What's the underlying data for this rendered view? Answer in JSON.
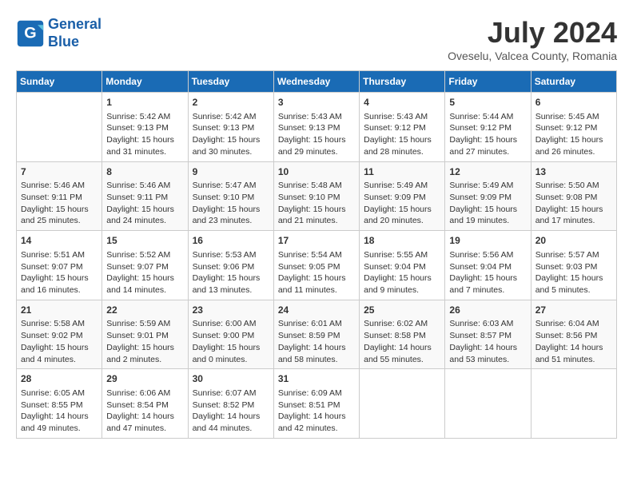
{
  "header": {
    "logo_line1": "General",
    "logo_line2": "Blue",
    "month": "July 2024",
    "location": "Oveselu, Valcea County, Romania"
  },
  "weekdays": [
    "Sunday",
    "Monday",
    "Tuesday",
    "Wednesday",
    "Thursday",
    "Friday",
    "Saturday"
  ],
  "weeks": [
    [
      {
        "day": "",
        "info": ""
      },
      {
        "day": "1",
        "info": "Sunrise: 5:42 AM\nSunset: 9:13 PM\nDaylight: 15 hours\nand 31 minutes."
      },
      {
        "day": "2",
        "info": "Sunrise: 5:42 AM\nSunset: 9:13 PM\nDaylight: 15 hours\nand 30 minutes."
      },
      {
        "day": "3",
        "info": "Sunrise: 5:43 AM\nSunset: 9:13 PM\nDaylight: 15 hours\nand 29 minutes."
      },
      {
        "day": "4",
        "info": "Sunrise: 5:43 AM\nSunset: 9:12 PM\nDaylight: 15 hours\nand 28 minutes."
      },
      {
        "day": "5",
        "info": "Sunrise: 5:44 AM\nSunset: 9:12 PM\nDaylight: 15 hours\nand 27 minutes."
      },
      {
        "day": "6",
        "info": "Sunrise: 5:45 AM\nSunset: 9:12 PM\nDaylight: 15 hours\nand 26 minutes."
      }
    ],
    [
      {
        "day": "7",
        "info": "Sunrise: 5:46 AM\nSunset: 9:11 PM\nDaylight: 15 hours\nand 25 minutes."
      },
      {
        "day": "8",
        "info": "Sunrise: 5:46 AM\nSunset: 9:11 PM\nDaylight: 15 hours\nand 24 minutes."
      },
      {
        "day": "9",
        "info": "Sunrise: 5:47 AM\nSunset: 9:10 PM\nDaylight: 15 hours\nand 23 minutes."
      },
      {
        "day": "10",
        "info": "Sunrise: 5:48 AM\nSunset: 9:10 PM\nDaylight: 15 hours\nand 21 minutes."
      },
      {
        "day": "11",
        "info": "Sunrise: 5:49 AM\nSunset: 9:09 PM\nDaylight: 15 hours\nand 20 minutes."
      },
      {
        "day": "12",
        "info": "Sunrise: 5:49 AM\nSunset: 9:09 PM\nDaylight: 15 hours\nand 19 minutes."
      },
      {
        "day": "13",
        "info": "Sunrise: 5:50 AM\nSunset: 9:08 PM\nDaylight: 15 hours\nand 17 minutes."
      }
    ],
    [
      {
        "day": "14",
        "info": "Sunrise: 5:51 AM\nSunset: 9:07 PM\nDaylight: 15 hours\nand 16 minutes."
      },
      {
        "day": "15",
        "info": "Sunrise: 5:52 AM\nSunset: 9:07 PM\nDaylight: 15 hours\nand 14 minutes."
      },
      {
        "day": "16",
        "info": "Sunrise: 5:53 AM\nSunset: 9:06 PM\nDaylight: 15 hours\nand 13 minutes."
      },
      {
        "day": "17",
        "info": "Sunrise: 5:54 AM\nSunset: 9:05 PM\nDaylight: 15 hours\nand 11 minutes."
      },
      {
        "day": "18",
        "info": "Sunrise: 5:55 AM\nSunset: 9:04 PM\nDaylight: 15 hours\nand 9 minutes."
      },
      {
        "day": "19",
        "info": "Sunrise: 5:56 AM\nSunset: 9:04 PM\nDaylight: 15 hours\nand 7 minutes."
      },
      {
        "day": "20",
        "info": "Sunrise: 5:57 AM\nSunset: 9:03 PM\nDaylight: 15 hours\nand 5 minutes."
      }
    ],
    [
      {
        "day": "21",
        "info": "Sunrise: 5:58 AM\nSunset: 9:02 PM\nDaylight: 15 hours\nand 4 minutes."
      },
      {
        "day": "22",
        "info": "Sunrise: 5:59 AM\nSunset: 9:01 PM\nDaylight: 15 hours\nand 2 minutes."
      },
      {
        "day": "23",
        "info": "Sunrise: 6:00 AM\nSunset: 9:00 PM\nDaylight: 15 hours\nand 0 minutes."
      },
      {
        "day": "24",
        "info": "Sunrise: 6:01 AM\nSunset: 8:59 PM\nDaylight: 14 hours\nand 58 minutes."
      },
      {
        "day": "25",
        "info": "Sunrise: 6:02 AM\nSunset: 8:58 PM\nDaylight: 14 hours\nand 55 minutes."
      },
      {
        "day": "26",
        "info": "Sunrise: 6:03 AM\nSunset: 8:57 PM\nDaylight: 14 hours\nand 53 minutes."
      },
      {
        "day": "27",
        "info": "Sunrise: 6:04 AM\nSunset: 8:56 PM\nDaylight: 14 hours\nand 51 minutes."
      }
    ],
    [
      {
        "day": "28",
        "info": "Sunrise: 6:05 AM\nSunset: 8:55 PM\nDaylight: 14 hours\nand 49 minutes."
      },
      {
        "day": "29",
        "info": "Sunrise: 6:06 AM\nSunset: 8:54 PM\nDaylight: 14 hours\nand 47 minutes."
      },
      {
        "day": "30",
        "info": "Sunrise: 6:07 AM\nSunset: 8:52 PM\nDaylight: 14 hours\nand 44 minutes."
      },
      {
        "day": "31",
        "info": "Sunrise: 6:09 AM\nSunset: 8:51 PM\nDaylight: 14 hours\nand 42 minutes."
      },
      {
        "day": "",
        "info": ""
      },
      {
        "day": "",
        "info": ""
      },
      {
        "day": "",
        "info": ""
      }
    ]
  ]
}
